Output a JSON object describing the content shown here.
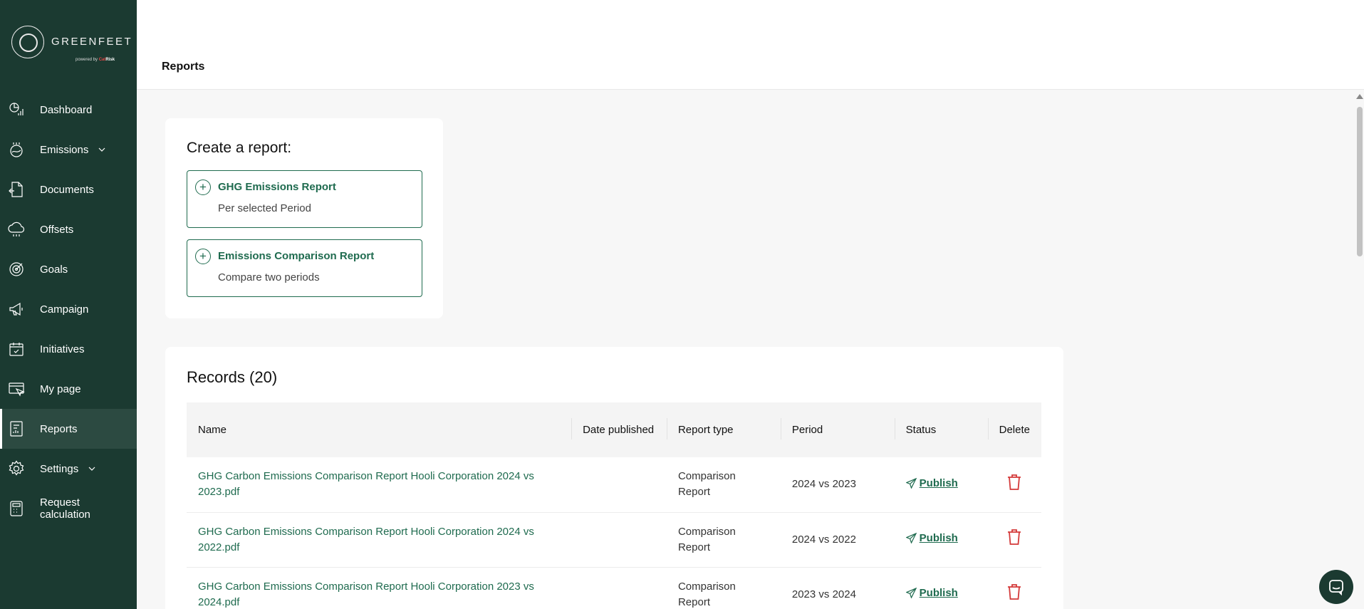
{
  "brand": {
    "name": "GREENFEET",
    "powered_by": "powered by",
    "powered_brand_a": "Cat",
    "powered_brand_b": "Risk"
  },
  "sidebar": {
    "items": [
      {
        "label": "Dashboard",
        "icon": "dashboard-icon"
      },
      {
        "label": "Emissions",
        "icon": "emissions-icon",
        "has_chevron": true
      },
      {
        "label": "Documents",
        "icon": "documents-icon"
      },
      {
        "label": "Offsets",
        "icon": "offsets-icon"
      },
      {
        "label": "Goals",
        "icon": "goals-icon"
      },
      {
        "label": "Campaign",
        "icon": "campaign-icon"
      },
      {
        "label": "Initiatives",
        "icon": "initiatives-icon"
      },
      {
        "label": "My page",
        "icon": "my-page-icon"
      },
      {
        "label": "Reports",
        "icon": "reports-icon",
        "active": true
      },
      {
        "label": "Settings",
        "icon": "settings-icon",
        "has_chevron": true
      },
      {
        "label": "Request calculation",
        "icon": "calculator-icon"
      }
    ]
  },
  "header": {
    "title": "Reports"
  },
  "create": {
    "title": "Create a report:",
    "options": [
      {
        "title": "GHG Emissions Report",
        "subtitle": "Per selected Period"
      },
      {
        "title": "Emissions Comparison Report",
        "subtitle": "Compare two periods"
      }
    ]
  },
  "records": {
    "title": "Records (20)",
    "columns": [
      "Name",
      "Date published",
      "Report type",
      "Period",
      "Status",
      "Delete"
    ],
    "rows": [
      {
        "name": "GHG Carbon Emissions Comparison Report Hooli Corporation 2024 vs 2023.pdf",
        "date_published": "",
        "report_type": "Comparison Report",
        "period": "2024 vs 2023",
        "status": "Publish"
      },
      {
        "name": "GHG Carbon Emissions Comparison Report Hooli Corporation 2024 vs 2022.pdf",
        "date_published": "",
        "report_type": "Comparison Report",
        "period": "2024 vs 2022",
        "status": "Publish"
      },
      {
        "name": "GHG Carbon Emissions Comparison Report Hooli Corporation 2023 vs 2024.pdf",
        "date_published": "",
        "report_type": "Comparison Report",
        "period": "2023 vs 2024",
        "status": "Publish"
      }
    ]
  },
  "colors": {
    "sidebar_bg": "#1b3a31",
    "accent_green": "#1f6b4f",
    "delete_red": "#d43a3a"
  }
}
